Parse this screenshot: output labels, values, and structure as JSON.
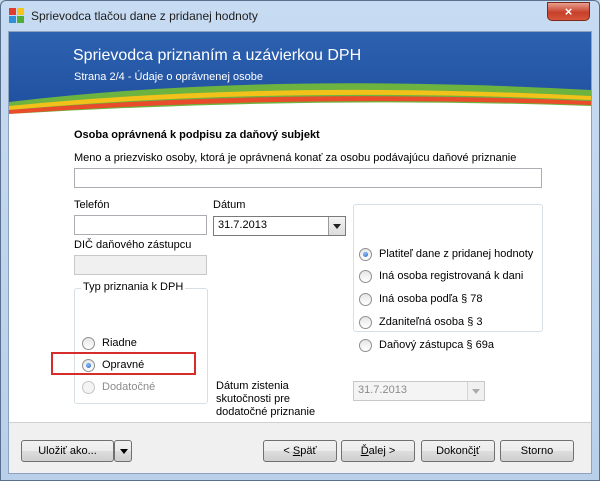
{
  "window": {
    "title": "Sprievodca tlačou dane z pridanej hodnoty",
    "close_glyph": "×"
  },
  "banner": {
    "title": "Sprievodca priznaním a uzávierkou DPH",
    "subtitle": "Strana 2/4 - Údaje o oprávnenej osobe"
  },
  "form": {
    "section_title": "Osoba oprávnená k podpisu za daňový subjekt",
    "name": {
      "label": "Meno a priezvisko osoby, ktorá je oprávnená konať za osobu podávajúcu daňové priznanie",
      "value": ""
    },
    "phone": {
      "label": "Telefón",
      "value": ""
    },
    "date": {
      "label": "Dátum",
      "value": "31.7.2013"
    },
    "dic": {
      "label": "DIČ daňového zástupcu",
      "value": ""
    },
    "return_type": {
      "legend": "Typ priznania k DPH",
      "options": [
        {
          "label": "Riadne",
          "selected": false,
          "enabled": true
        },
        {
          "label": "Opravné",
          "selected": true,
          "enabled": true
        },
        {
          "label": "Dodatočné",
          "selected": false,
          "enabled": false
        }
      ]
    },
    "discovery_date": {
      "label_line1": "Dátum zistenia",
      "label_line2": "skutočnosti pre",
      "label_line3": "dodatočné priznanie",
      "value": "31.7.2013",
      "enabled": false
    },
    "person_type": {
      "options": [
        {
          "label": "Platiteľ dane z pridanej hodnoty",
          "selected": true
        },
        {
          "label": "Iná osoba registrovaná k dani",
          "selected": false
        },
        {
          "label": "Iná osoba podľa § 78",
          "selected": false
        },
        {
          "label": "Zdaniteľná osoba § 3",
          "selected": false
        },
        {
          "label": "Daňový zástupca § 69a",
          "selected": false
        }
      ]
    }
  },
  "footer": {
    "save_as": "Uložiť ako...",
    "back_prefix": "< ",
    "back_key": "S",
    "back_rest": "päť",
    "next_key": "Ď",
    "next_rest": "alej >",
    "finish_prefix": "Dokonč",
    "finish_key": "i",
    "finish_rest": "ť",
    "cancel": "Storno"
  },
  "colors": {
    "banner_blue": "#2156a6",
    "highlight_red": "#d72c2c"
  }
}
